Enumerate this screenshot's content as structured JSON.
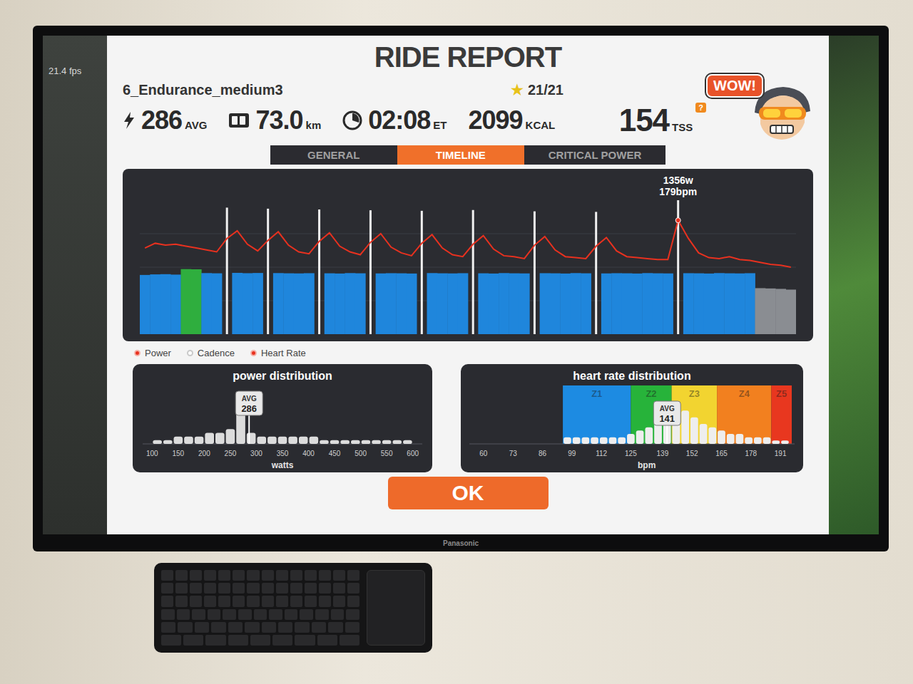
{
  "screen": {
    "fps": "21.4 fps"
  },
  "tv": {
    "brand": "Panasonic"
  },
  "report": {
    "title": "RIDE REPORT",
    "workout": "6_Endurance_medium3",
    "stars": {
      "icon": "★",
      "text": "21/21"
    },
    "badge": "WOW!",
    "stats": [
      {
        "kind": "power",
        "value": "286",
        "unit": "AVG"
      },
      {
        "kind": "distance",
        "value": "73.0",
        "unit": "km"
      },
      {
        "kind": "time",
        "value": "02:08",
        "unit": "ET"
      },
      {
        "kind": "plain",
        "value": "2099",
        "unit": "KCAL"
      },
      {
        "kind": "tss",
        "value": "154",
        "unit": "TSS",
        "help": "?"
      }
    ],
    "tabs": [
      {
        "label": "GENERAL",
        "selected": false
      },
      {
        "label": "TIMELINE",
        "selected": true
      },
      {
        "label": "CRITICAL POWER",
        "selected": false
      }
    ],
    "timeline": {
      "power": [
        265,
        270,
        272,
        268,
        320,
        318,
        282,
        280,
        1210,
        284,
        281,
        283,
        1190,
        282,
        280,
        279,
        281,
        1175,
        280,
        278,
        282,
        280,
        1160,
        279,
        281,
        280,
        278,
        1150,
        282,
        280,
        279,
        281,
        1165,
        280,
        278,
        282,
        280,
        279,
        1140,
        281,
        280,
        278,
        282,
        280,
        1130,
        279,
        281,
        280,
        278,
        282,
        280,
        279,
        1356,
        281,
        280,
        278,
        282,
        280,
        279,
        281,
        160,
        158,
        155,
        150
      ],
      "heart_rate": [
        150,
        155,
        153,
        154,
        152,
        150,
        148,
        146,
        160,
        168,
        154,
        147,
        158,
        167,
        153,
        146,
        144,
        157,
        166,
        152,
        146,
        143,
        156,
        165,
        151,
        145,
        142,
        155,
        164,
        150,
        143,
        141,
        154,
        163,
        149,
        142,
        141,
        139,
        153,
        162,
        148,
        141,
        140,
        139,
        152,
        161,
        147,
        141,
        140,
        139,
        138,
        138,
        179,
        160,
        145,
        140,
        139,
        141,
        138,
        137,
        135,
        133,
        132,
        130
      ],
      "tooltip": {
        "index": 52,
        "power": "1356w",
        "heart_rate": "179bpm"
      },
      "legend": [
        {
          "label": "Power",
          "on": true
        },
        {
          "label": "Cadence",
          "on": false
        },
        {
          "label": "Heart Rate",
          "on": true
        }
      ]
    },
    "power_distribution": {
      "title": "power distribution",
      "avg_label": "AVG",
      "avg": "286",
      "ticks": [
        "100",
        "150",
        "200",
        "250",
        "300",
        "350",
        "400",
        "450",
        "500",
        "550",
        "600"
      ],
      "unit": "watts",
      "bin_start": 100,
      "bin_width": 20,
      "bins": [
        1,
        1,
        2,
        2,
        2,
        3,
        3,
        4,
        12,
        3,
        2,
        2,
        2,
        2,
        2,
        2,
        1,
        1,
        1,
        1,
        1,
        1,
        1,
        1,
        1
      ]
    },
    "heart_rate_distribution": {
      "title": "heart rate distribution",
      "avg_label": "AVG",
      "avg": "141",
      "ticks": [
        "60",
        "73",
        "86",
        "99",
        "112",
        "125",
        "139",
        "152",
        "165",
        "178",
        "191"
      ],
      "unit": "bpm",
      "zones": [
        {
          "label": "Z1",
          "from": 95,
          "to": 125,
          "color": "#1d8be2"
        },
        {
          "label": "Z2",
          "from": 125,
          "to": 143,
          "color": "#27b33a"
        },
        {
          "label": "Z3",
          "from": 143,
          "to": 163,
          "color": "#f2d430"
        },
        {
          "label": "Z4",
          "from": 163,
          "to": 187,
          "color": "#f2801f"
        },
        {
          "label": "Z5",
          "from": 187,
          "to": 196,
          "color": "#e8371f"
        }
      ],
      "bin_start": 95,
      "bin_width": 4,
      "bins": [
        2,
        2,
        2,
        2,
        2,
        2,
        2,
        3,
        4,
        5,
        7,
        10,
        12,
        10,
        8,
        6,
        5,
        4,
        3,
        3,
        2,
        2,
        2,
        1,
        1
      ]
    },
    "button": "OK"
  }
}
